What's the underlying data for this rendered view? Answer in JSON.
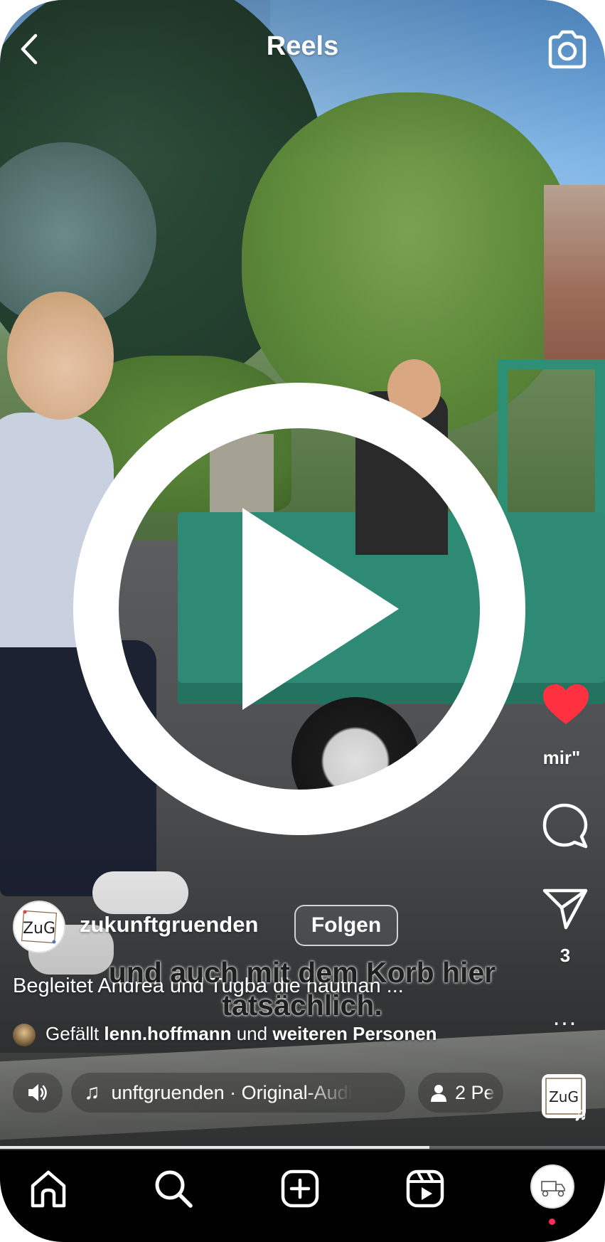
{
  "header": {
    "title": "Reels",
    "back_icon": "chevron-left-icon",
    "camera_icon": "camera-icon"
  },
  "video": {
    "subtitle": "und auch mit dem Korb hier tatsächlich.",
    "overlay_text_partial": "mir\"",
    "playback_state": "paused",
    "progress_fraction": 0.71
  },
  "author": {
    "username": "zukunftgruenden",
    "avatar_text": "ZuG",
    "follow_label": "Folgen"
  },
  "caption": {
    "text": "Begleitet Andrea und Tugba die hautnah ..."
  },
  "likes": {
    "prefix": "Gefällt",
    "user": "lenn.hoffmann",
    "middle": "und",
    "suffix": "weiteren Personen"
  },
  "actions": {
    "like_icon": "heart-filled-icon",
    "like_count": "mir\"",
    "comment_icon": "comment-icon",
    "share_icon": "send-icon",
    "share_count": "3",
    "more_icon": "more-horizontal-icon",
    "more_label": "..."
  },
  "audio": {
    "volume_icon": "volume-icon",
    "music_icon": "music-note-icon",
    "track_label": "unftgruenden · Original-Audi",
    "people_icon": "person-icon",
    "people_label": "2 Pe",
    "thumb_text": "ZuG"
  },
  "nav": {
    "items": [
      {
        "icon": "home-icon"
      },
      {
        "icon": "search-icon"
      },
      {
        "icon": "plus-square-icon"
      },
      {
        "icon": "reels-icon"
      },
      {
        "icon": "profile-avatar"
      }
    ]
  },
  "colors": {
    "like_red": "#ff3040",
    "nav_bg": "#000000",
    "notification_dot": "#ff2d55"
  }
}
